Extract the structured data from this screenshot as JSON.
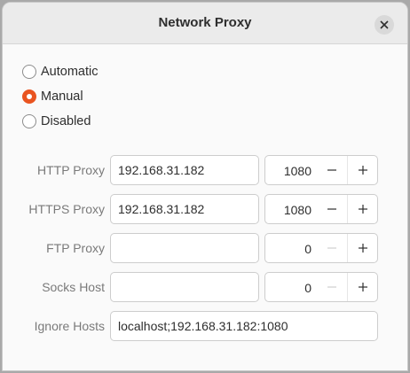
{
  "window": {
    "title": "Network Proxy"
  },
  "methods": [
    {
      "label": "Automatic",
      "checked": false
    },
    {
      "label": "Manual",
      "checked": true
    },
    {
      "label": "Disabled",
      "checked": false
    }
  ],
  "proxies": {
    "http": {
      "label": "HTTP Proxy",
      "host": "192.168.31.182",
      "port": "1080"
    },
    "https": {
      "label": "HTTPS Proxy",
      "host": "192.168.31.182",
      "port": "1080"
    },
    "ftp": {
      "label": "FTP Proxy",
      "host": "",
      "port": "0"
    },
    "socks": {
      "label": "Socks Host",
      "host": "",
      "port": "0"
    }
  },
  "ignore_hosts": {
    "label": "Ignore Hosts",
    "value": "localhost;192.168.31.182:1080"
  },
  "colors": {
    "accent": "#e95420",
    "titlebar": "#ebebeb",
    "label": "#7a7a7a"
  },
  "icons": {
    "close": "close-icon",
    "minus": "minus-icon",
    "plus": "plus-icon"
  }
}
